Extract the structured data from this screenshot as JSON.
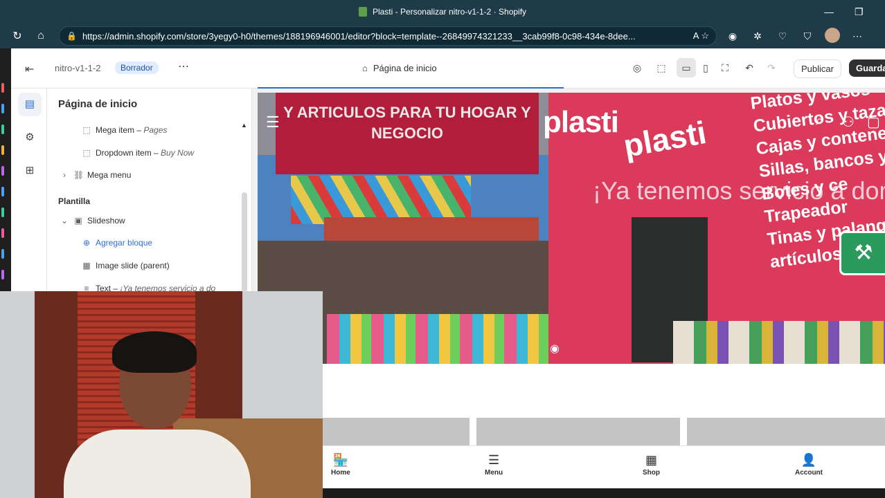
{
  "browser": {
    "title": "Plasti - Personalizar nitro-v1-1-2 · Shopify",
    "url": "https://admin.shopify.com/store/3yegy0-h0/themes/188196946001/editor?block=template--26849974321233__3cab99f8-0c98-434e-8dee...",
    "reader_icon": "A",
    "window_controls": {
      "minimize": "—",
      "restore": "❐"
    },
    "nav_icons": {
      "refresh": "↻",
      "home": "⌂"
    },
    "extensions": [
      "shield-ext-icon",
      "puzzle-icon",
      "heart-icon",
      "shield-icon"
    ],
    "more": "⋯"
  },
  "editor": {
    "exit_icon": "⇤",
    "theme_name": "nitro-v1-1-2",
    "status_badge": "Borrador",
    "more_icon": "⋯",
    "page_selector": "Página de inicio",
    "publish": "Publicar",
    "save": "Guardar",
    "sidebar": {
      "title": "Página de inicio",
      "items": [
        {
          "icon": "⬚",
          "label": "Mega item",
          "sub": "Pages"
        },
        {
          "icon": "⬚",
          "label": "Dropdown item",
          "sub": "Buy Now"
        },
        {
          "icon": "🔗",
          "label": "Mega menu"
        }
      ],
      "section_title": "Plantilla",
      "template_items": [
        {
          "icon": "▣",
          "label": "Slideshow"
        },
        {
          "icon": "⊕",
          "label": "Agregar bloque"
        },
        {
          "icon": "▦",
          "label": "Image slide (parent)"
        },
        {
          "icon": "≡",
          "label": "Text",
          "sub": "¡Ya tenemos servicio a do"
        }
      ]
    }
  },
  "preview": {
    "logo": "plasti",
    "heading": "¡Ya tenemos servicio a domicilio",
    "sign_text": "Y ARTICULOS PARA TU HOGAR Y NEGOCIO",
    "wall_brand": "plasti",
    "wall_text": "Platos y vasos\nCubiertos y tazas\nCajas y contene\nSillas, bancos y\nBotes y ce\nTrapeador\nTinas y palanga\nartículos de lim",
    "bottom_nav": [
      {
        "icon": "🏪",
        "label": "Home"
      },
      {
        "icon": "☰",
        "label": "Menu"
      },
      {
        "icon": "▦",
        "label": "Shop"
      },
      {
        "icon": "👤",
        "label": "Account"
      }
    ]
  },
  "colors": {
    "accent": "#2c6ecb",
    "brand_red": "#dc3a5b",
    "tools_green": "#2b9a5c"
  }
}
